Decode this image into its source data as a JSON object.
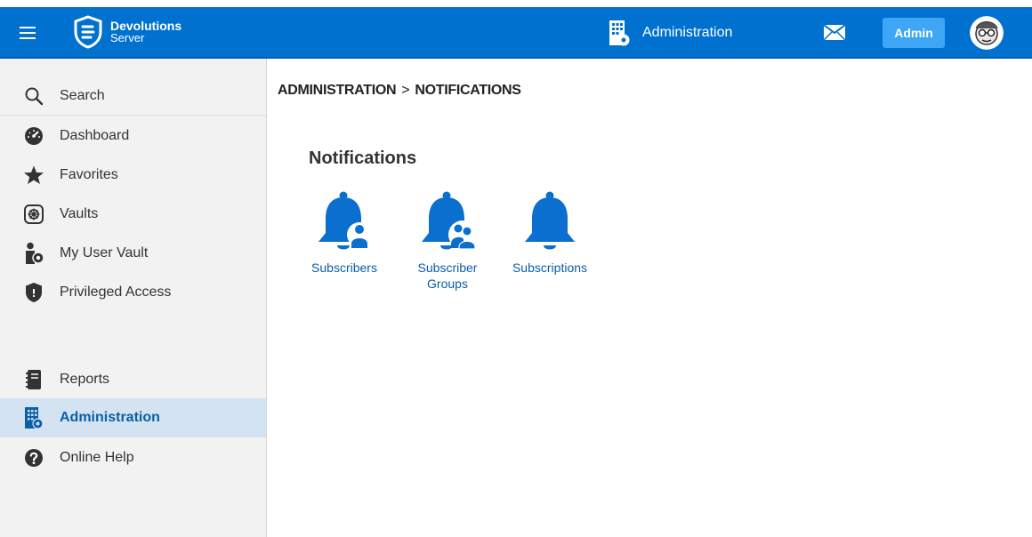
{
  "topbar": {
    "logo_title": "Devolutions",
    "logo_sub": "Server",
    "section_label": "Administration",
    "admin_button": "Admin",
    "icons": [
      "hamburger-icon",
      "mail-icon",
      "admin-building-icon"
    ],
    "accent_color": "#0071ce"
  },
  "sidebar": {
    "items": [
      {
        "label": "Search",
        "icon": "search-icon"
      },
      {
        "label": "Dashboard",
        "icon": "dashboard-icon"
      },
      {
        "label": "Favorites",
        "icon": "star-icon"
      },
      {
        "label": "Vaults",
        "icon": "vault-icon"
      },
      {
        "label": "My User Vault",
        "icon": "user-vault-icon"
      },
      {
        "label": "Privileged Access",
        "icon": "shield-icon"
      },
      {
        "label": "Reports",
        "icon": "reports-icon"
      },
      {
        "label": "Administration",
        "icon": "admin-building-icon",
        "active": true
      },
      {
        "label": "Online Help",
        "icon": "help-icon"
      }
    ]
  },
  "main": {
    "breadcrumb": [
      "ADMINISTRATION",
      "NOTIFICATIONS"
    ],
    "breadcrumb_separator": ">",
    "section_title": "Notifications",
    "tiles": [
      {
        "label": "Subscribers",
        "icon": "bell-user-icon"
      },
      {
        "label": "Subscriber Groups",
        "icon": "bell-group-icon"
      },
      {
        "label": "Subscriptions",
        "icon": "bell-icon"
      }
    ]
  }
}
